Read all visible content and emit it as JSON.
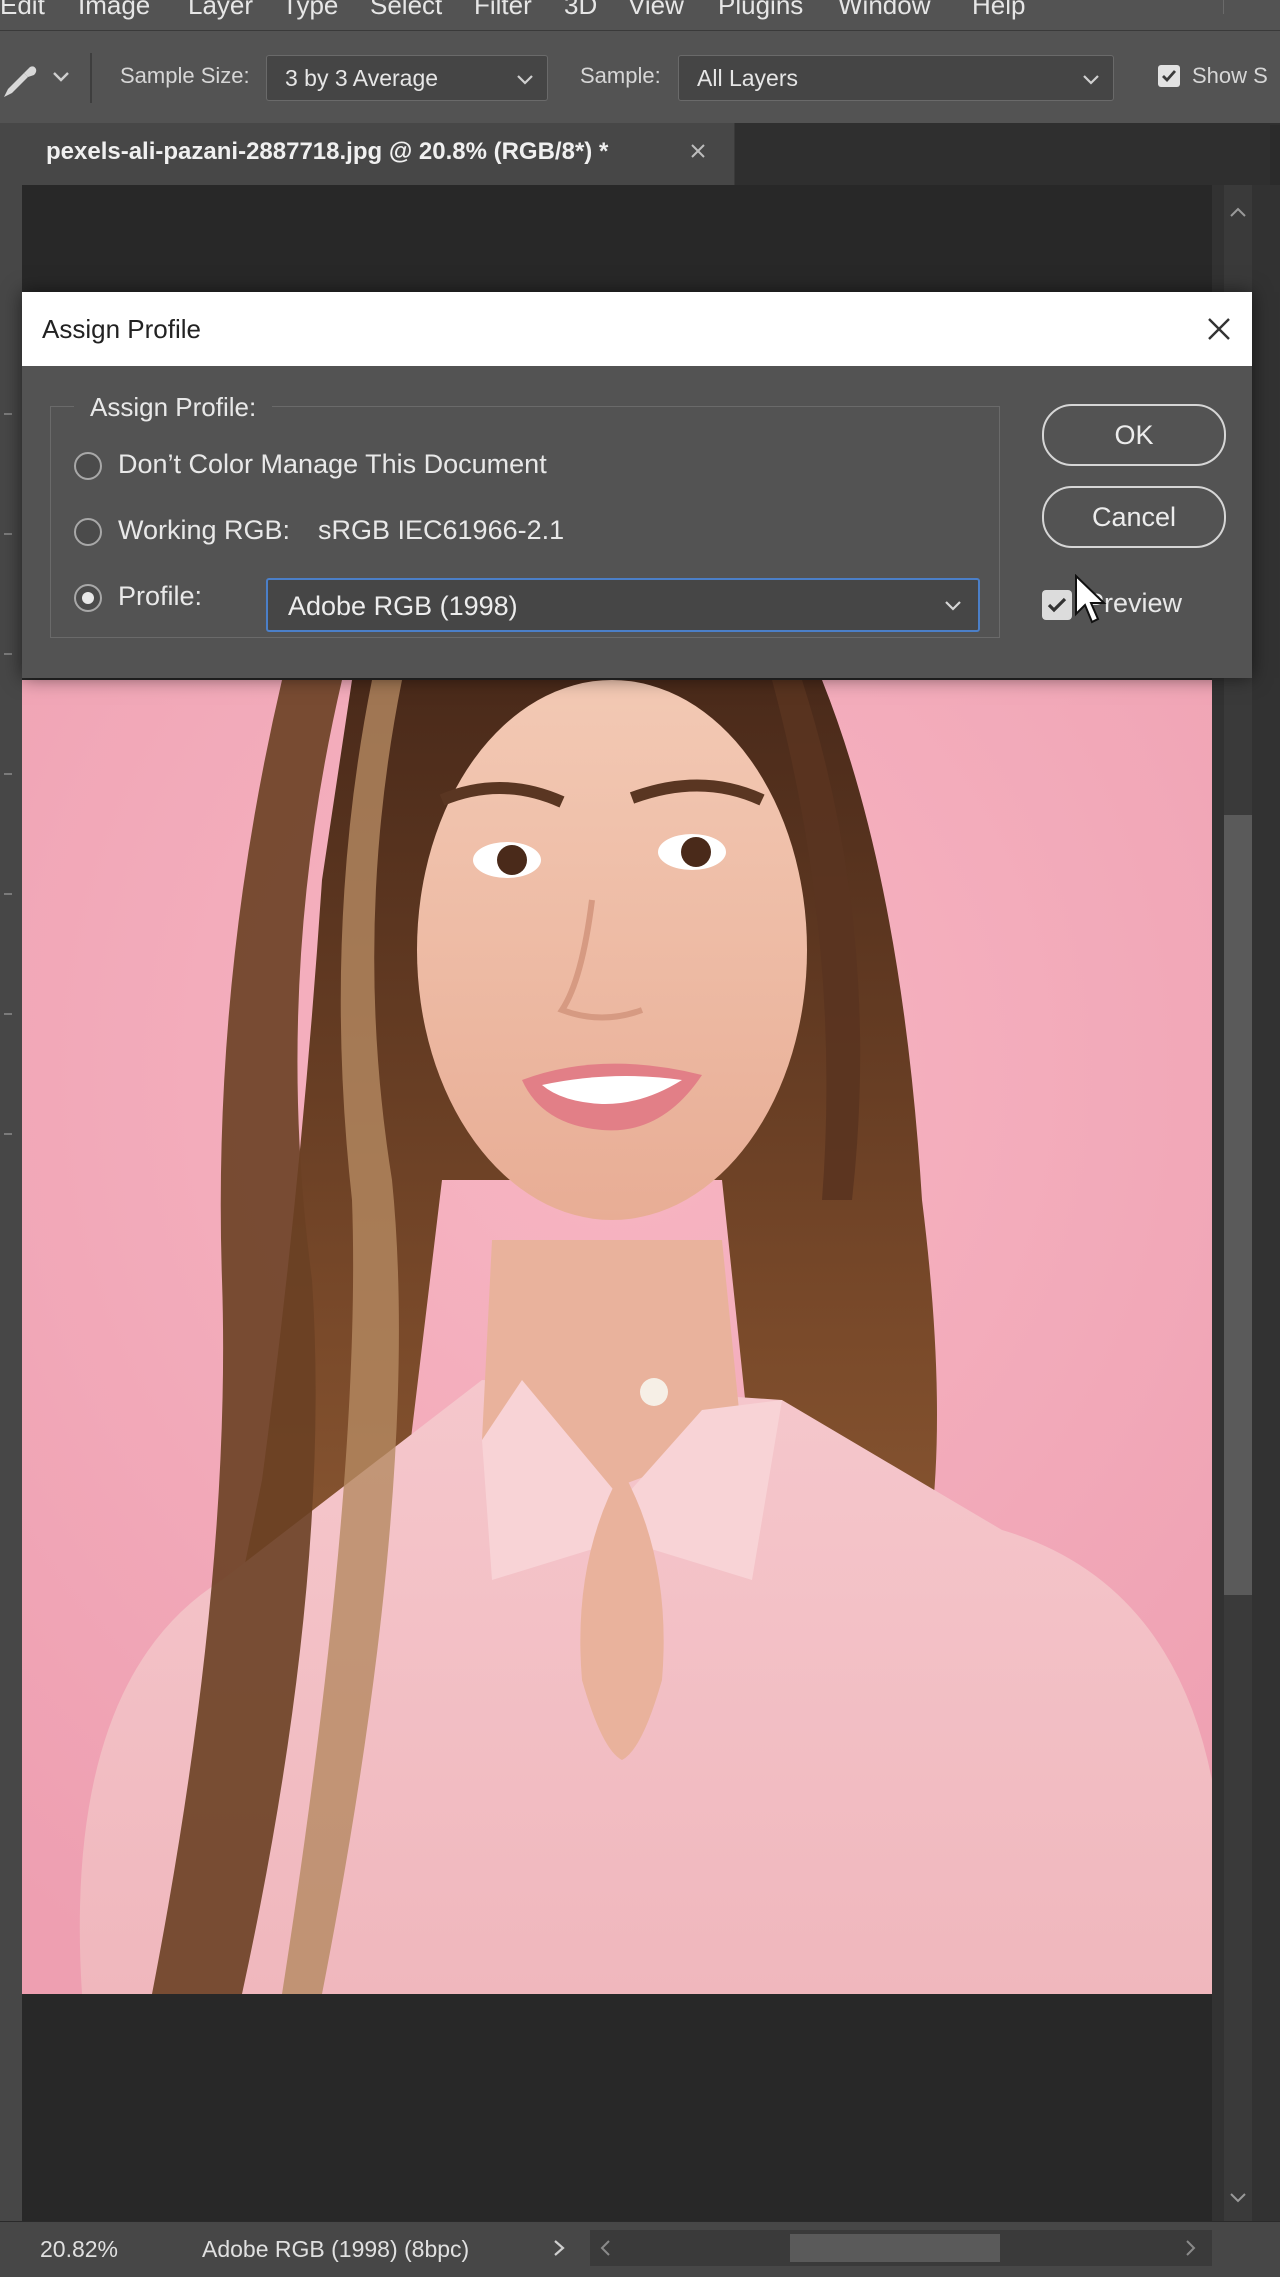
{
  "menubar": {
    "items": [
      "Edit",
      "Image",
      "Layer",
      "Type",
      "Select",
      "Filter",
      "3D",
      "View",
      "Plugins",
      "Window",
      "Help"
    ]
  },
  "options_bar": {
    "tool_icon": "eyedropper-icon",
    "sample_size_label": "Sample Size:",
    "sample_size_value": "3 by 3 Average",
    "sample_label": "Sample:",
    "sample_value": "All Layers",
    "show_label": "Show S"
  },
  "document_tab": {
    "title": "pexels-ali-pazani-2887718.jpg @ 20.8% (RGB/8*) *"
  },
  "dialog": {
    "title": "Assign Profile",
    "group_label": "Assign Profile:",
    "options": {
      "dont_manage": "Don’t Color Manage This Document",
      "working_rgb_label": "Working RGB:",
      "working_rgb_value": "sRGB IEC61966-2.1",
      "profile_label": "Profile:"
    },
    "selected_option": "profile",
    "profile_value": "Adobe RGB (1998)",
    "ok_label": "OK",
    "cancel_label": "Cancel",
    "preview_label": "Preview",
    "preview_checked": true
  },
  "status_bar": {
    "zoom": "20.82%",
    "doc_info": "Adobe RGB (1998) (8bpc)"
  },
  "colors": {
    "accent": "#4b7fc8",
    "panel": "#535353",
    "canvas": "#282828",
    "photo_background": "#f2a8b9"
  }
}
